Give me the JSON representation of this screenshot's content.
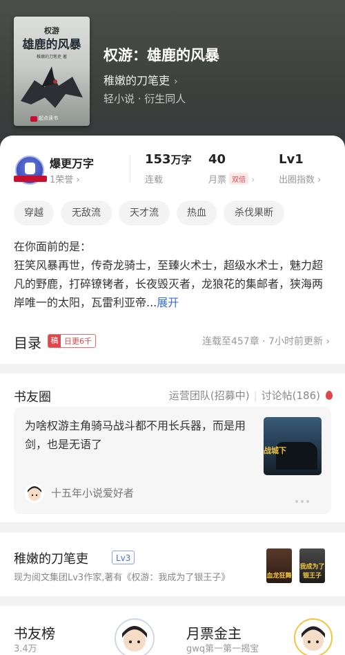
{
  "book": {
    "title": "权游：雄鹿的风暴",
    "author": "稚嫩的刀笔吏",
    "chevron": "›",
    "tags": "轻小说 · 衍生同人",
    "cover": {
      "subtitle": "权游",
      "title": "雄鹿的风暴",
      "author_line": "稚嫩的刀笔吏 著",
      "publisher": "起点读书"
    }
  },
  "honor": {
    "title": "爆更万字",
    "sub": "1荣誉 ›"
  },
  "stats": [
    {
      "value": "153",
      "unit": "万字",
      "label": "连载",
      "badge": ""
    },
    {
      "value": "40",
      "unit": "",
      "label": "月票",
      "badge": "双倍"
    },
    {
      "value": "Lv1",
      "unit": "",
      "label": "出圈指数 ›",
      "badge": ""
    }
  ],
  "tags": [
    "穿越",
    "无敌流",
    "天才流",
    "热血",
    "杀伐果断"
  ],
  "description": {
    "text": "在你面前的是：\n狂笑风暴再世，传奇龙骑士，至臻火术士，超级水术士，魅力超凡的野鹿，打碎镣铐者，长夜毁灭者，龙狼花的集邮者，狭海两岸唯一的太阳，瓦雷利亚帝...",
    "more": "展开"
  },
  "toc": {
    "title": "目录",
    "badge_mark": "稿",
    "badge_text": "日更6千",
    "info": "连载至457章 · 7小时前更新 ›"
  },
  "circle": {
    "title": "书友圈",
    "link_team": "运营团队(招募中)",
    "separator": "|",
    "link_posts": "讨论帖(186)",
    "post_text": "为啥权游主角骑马战斗都不用长兵器，而是用剑，也是无语了",
    "post_image_caption": "战城下",
    "post_user": "十五年小说爱好者"
  },
  "author_section": {
    "name": "稚嫩的刀笔吏",
    "level": "Lv3",
    "desc": "现为阅文集团Lv3作家,著有《权游：我成为了银王子》",
    "books": [
      {
        "caption": "血龙狂舞"
      },
      {
        "caption": "我成为了银王子"
      }
    ]
  },
  "ranks": [
    {
      "title": "书友榜",
      "sub": "3.4万"
    },
    {
      "title": "月票金主",
      "sub": "gwq第一第一揭宝"
    }
  ],
  "colors": {
    "hero_bg": "#3f4340",
    "accent_red": "#e0474c",
    "link_blue": "#3a6fd8"
  }
}
